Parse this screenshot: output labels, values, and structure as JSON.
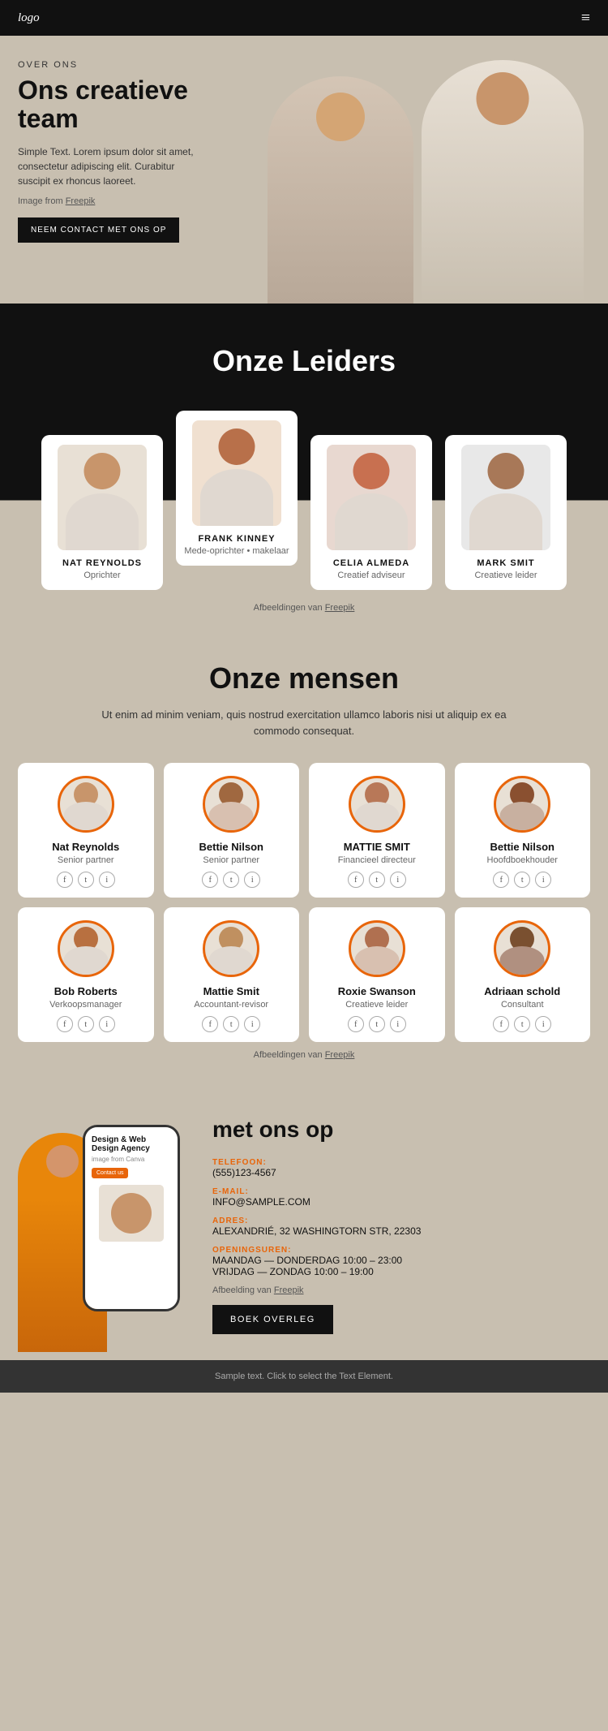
{
  "header": {
    "logo": "logo",
    "menu_icon": "≡"
  },
  "hero": {
    "label": "OVER ONS",
    "title": "Ons creatieve team",
    "text": "Simple Text. Lorem ipsum dolor sit amet, consectetur adipiscing elit. Curabitur suscipit ex rhoncus laoreet.",
    "image_credit_prefix": "Image from",
    "image_credit_link": "Freepik",
    "cta_button": "NEEM CONTACT MET ONS OP"
  },
  "leiders": {
    "title": "Onze Leiders",
    "people": [
      {
        "name": "NAT REYNOLDS",
        "role": "Oprichter"
      },
      {
        "name": "FRANK KINNEY",
        "role": "Mede-oprichter • makelaar"
      },
      {
        "name": "CELIA ALMEDA",
        "role": "Creatief adviseur"
      },
      {
        "name": "MARK SMIT",
        "role": "Creatieve leider"
      }
    ],
    "credit_prefix": "Afbeeldingen van",
    "credit_link": "Freepik"
  },
  "mensen": {
    "title": "Onze mensen",
    "description": "Ut enim ad minim veniam, quis nostrud exercitation ullamco laboris nisi ut aliquip ex ea commodo consequat.",
    "people": [
      {
        "name": "Nat Reynolds",
        "role": "Senior partner"
      },
      {
        "name": "Bettie Nilson",
        "role": "Senior partner"
      },
      {
        "name": "MATTIE SMIT",
        "role": "Financieel directeur"
      },
      {
        "name": "Bettie Nilson",
        "role": "Hoofdboekhouder"
      },
      {
        "name": "Bob Roberts",
        "role": "Verkoopsmanager"
      },
      {
        "name": "Mattie Smit",
        "role": "Accountant-revisor"
      },
      {
        "name": "Roxie Swanson",
        "role": "Creatieve leider"
      },
      {
        "name": "Adriaan schold",
        "role": "Consultant"
      }
    ],
    "credit_prefix": "Afbeeldingen van",
    "credit_link": "Freepik"
  },
  "contact": {
    "title": "met ons op",
    "phone_label": "TELEFOON:",
    "phone_value": "(555)123-4567",
    "email_label": "E-MAIL:",
    "email_value": "INFO@SAMPLE.COM",
    "address_label": "ADRES:",
    "address_value": "ALEXANDRIÉ, 32 WASHINGTORN STR, 22303",
    "hours_label": "OPENINGSUREN:",
    "hours_value1": "MAANDAG — DONDERDAG 10:00 – 23:00",
    "hours_value2": "VRIJDAG — ZONDAG 10:00 – 19:00",
    "credit_prefix": "Afbeelding van",
    "credit_link": "Freepik",
    "phone_screen_title": "Design & Web Design Agency",
    "phone_screen_sub": "image from Canva",
    "phone_screen_btn": "Contact us",
    "cta_button": "BOEK OVERLEG"
  },
  "footer": {
    "text": "Sample text. Click to select the Text Element."
  }
}
